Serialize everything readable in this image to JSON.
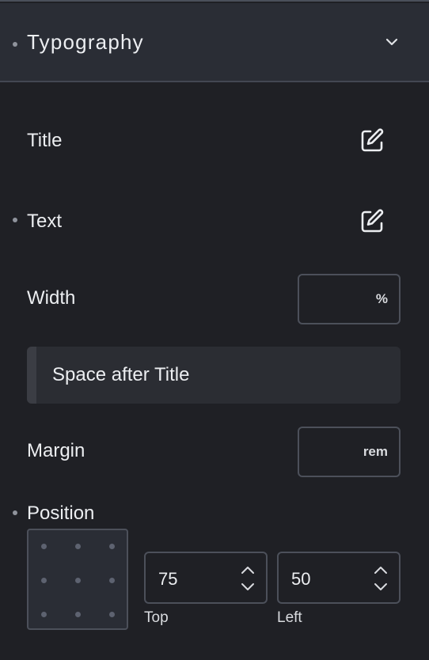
{
  "header": {
    "title": "Typography",
    "toggle_icon": "chevron-down-icon"
  },
  "rows": {
    "title_label": "Title",
    "text_label": "Text",
    "edit_icon": "edit-icon"
  },
  "width": {
    "label": "Width",
    "value": "",
    "unit": "%"
  },
  "space_after_title": {
    "label": "Space after Title"
  },
  "margin": {
    "label": "Margin",
    "value": "",
    "unit": "rem"
  },
  "position": {
    "label": "Position",
    "top": {
      "value": "75",
      "caption": "Top"
    },
    "left": {
      "value": "50",
      "caption": "Left"
    }
  },
  "colors": {
    "background": "#1f2025",
    "header_bg": "#2a2d35",
    "border": "#4c505a",
    "text": "#eceef1"
  }
}
